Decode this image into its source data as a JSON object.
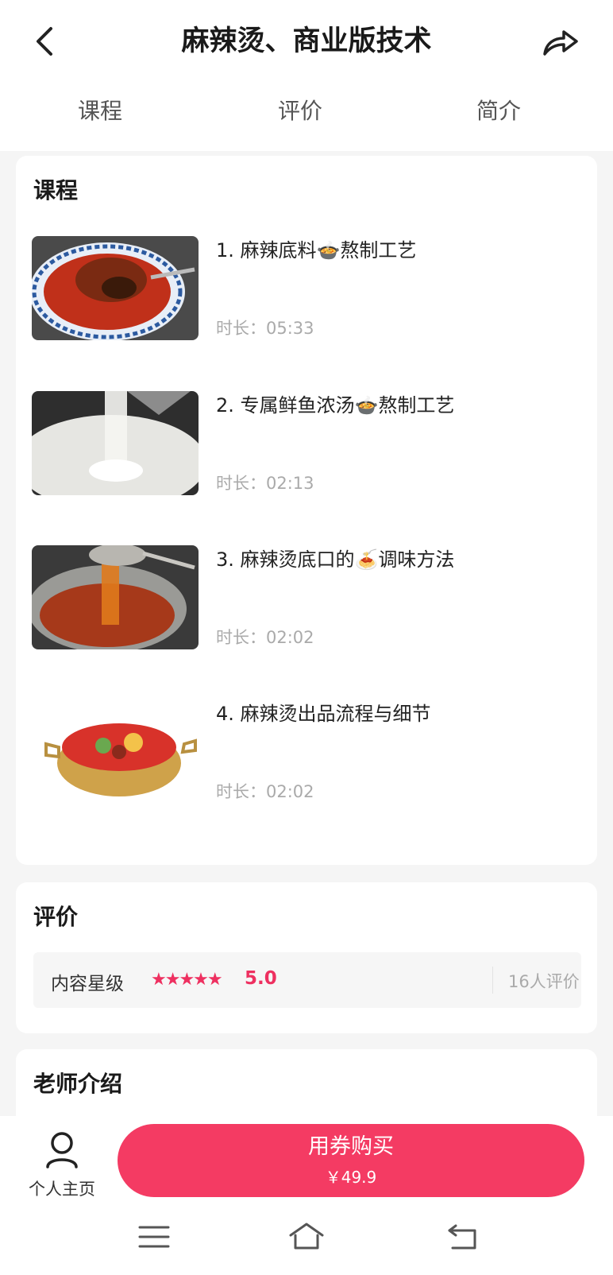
{
  "header": {
    "title": "麻辣烫、商业版技术"
  },
  "tabs": [
    {
      "label": "课程"
    },
    {
      "label": "评价"
    },
    {
      "label": "简介"
    }
  ],
  "courses_section": {
    "heading": "课程",
    "items": [
      {
        "title": "1. 麻辣底料🍲熬制工艺",
        "duration": "时长：05:33"
      },
      {
        "title": "2. 专属鲜鱼浓汤🍲熬制工艺",
        "duration": "时长：02:13"
      },
      {
        "title": "3. 麻辣烫底口的🍝调味方法",
        "duration": "时长：02:02"
      },
      {
        "title": "4. 麻辣烫出品流程与细节",
        "duration": "时长：02:02"
      }
    ]
  },
  "reviews_section": {
    "heading": "评价",
    "rating_label": "内容星级",
    "stars": "★★★★★",
    "score": "5.0",
    "count": "16人评价"
  },
  "teacher_section": {
    "heading": "老师介绍"
  },
  "bottom_bar": {
    "profile_label": "个人主页",
    "buy_label": "用券购买",
    "price": "￥49.9"
  },
  "colors": {
    "accent": "#f43b63",
    "star": "#ee3060"
  }
}
